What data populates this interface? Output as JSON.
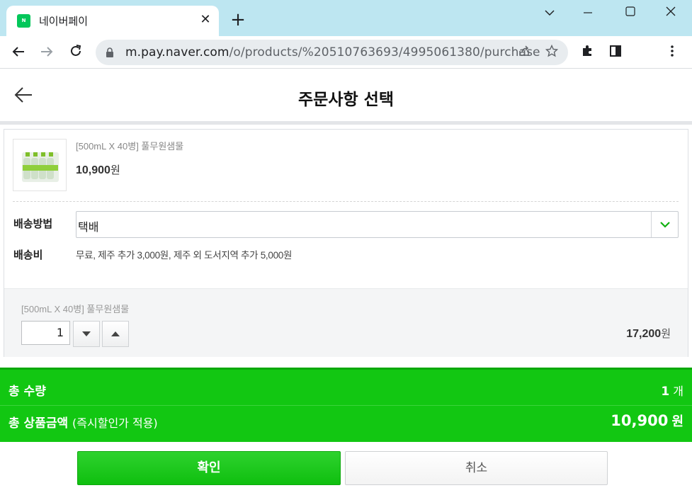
{
  "browser": {
    "tab_title": "네이버페이",
    "tab_favicon_text": "N Pay",
    "url_host": "m.pay.naver.com",
    "url_path": "/o/products/%20510763693/4995061380/purchase"
  },
  "page": {
    "title": "주문사항 선택"
  },
  "product": {
    "name": "[500mL X 40병] 풀무원샘물",
    "price_number": "10,900",
    "price_unit": "원"
  },
  "shipping": {
    "method_label": "배송방법",
    "method_value": "택배",
    "fee_label": "배송비",
    "fee_text": "무료, 제주 추가 3,000원, 제주 외 도서지역 추가 5,000원"
  },
  "option": {
    "name": "[500mL X 40병] 풀무원샘물",
    "quantity": "1",
    "price_number": "17,200",
    "price_unit": "원"
  },
  "summary": {
    "total_qty_label": "총 수량",
    "total_qty_number": "1",
    "total_qty_unit": "개",
    "total_amount_label": "총 상품금액",
    "total_amount_sub": "(즉시할인가 적용)",
    "total_amount_number": "10,900",
    "total_amount_unit": "원"
  },
  "buttons": {
    "confirm": "확인",
    "cancel": "취소"
  },
  "colors": {
    "accent_green": "#12c712",
    "tabstrip": "#bde6f1"
  }
}
